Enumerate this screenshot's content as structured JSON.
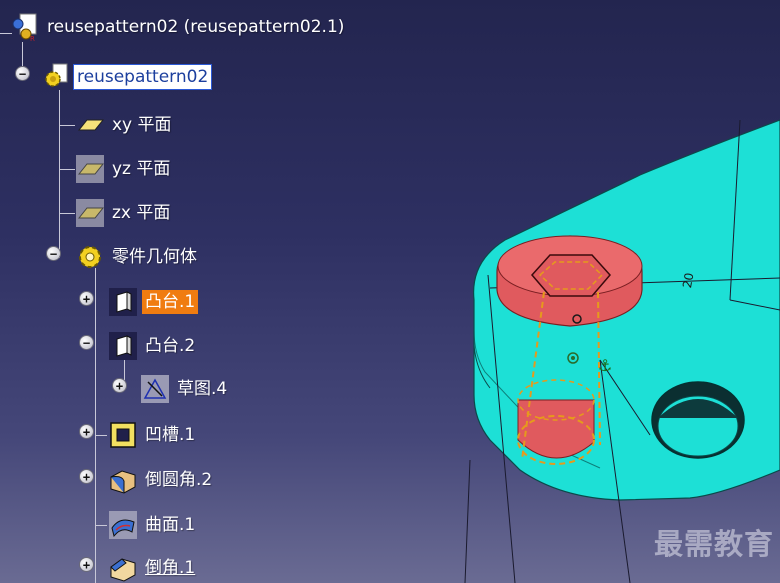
{
  "tree": {
    "root_label": "reusepattern02 (reusepattern02.1)",
    "part_label": "reusepattern02",
    "items": [
      {
        "label": "xy 平面",
        "icon": "plane-icon"
      },
      {
        "label": "yz 平面",
        "icon": "plane-icon"
      },
      {
        "label": "zx 平面",
        "icon": "plane-icon"
      },
      {
        "label": "零件几何体",
        "icon": "part-body-gear-icon"
      },
      {
        "label": "凸台.1",
        "icon": "pad-icon"
      },
      {
        "label": "凸台.2",
        "icon": "pad-icon"
      },
      {
        "label": "草图.4",
        "icon": "sketch-icon"
      },
      {
        "label": "凹槽.1",
        "icon": "pocket-icon"
      },
      {
        "label": "倒圆角.2",
        "icon": "edge-fillet-icon"
      },
      {
        "label": "曲面.1",
        "icon": "surface-icon"
      },
      {
        "label": "倒角.1",
        "icon": "chamfer-icon"
      }
    ]
  },
  "viewport": {
    "dimension_label": "20"
  },
  "watermark": "最需教育",
  "colors": {
    "part_body": "#1de0d6",
    "boss_head": "#e05a5e",
    "selection_orange": "#f07c10",
    "background_top": "#23254f"
  }
}
